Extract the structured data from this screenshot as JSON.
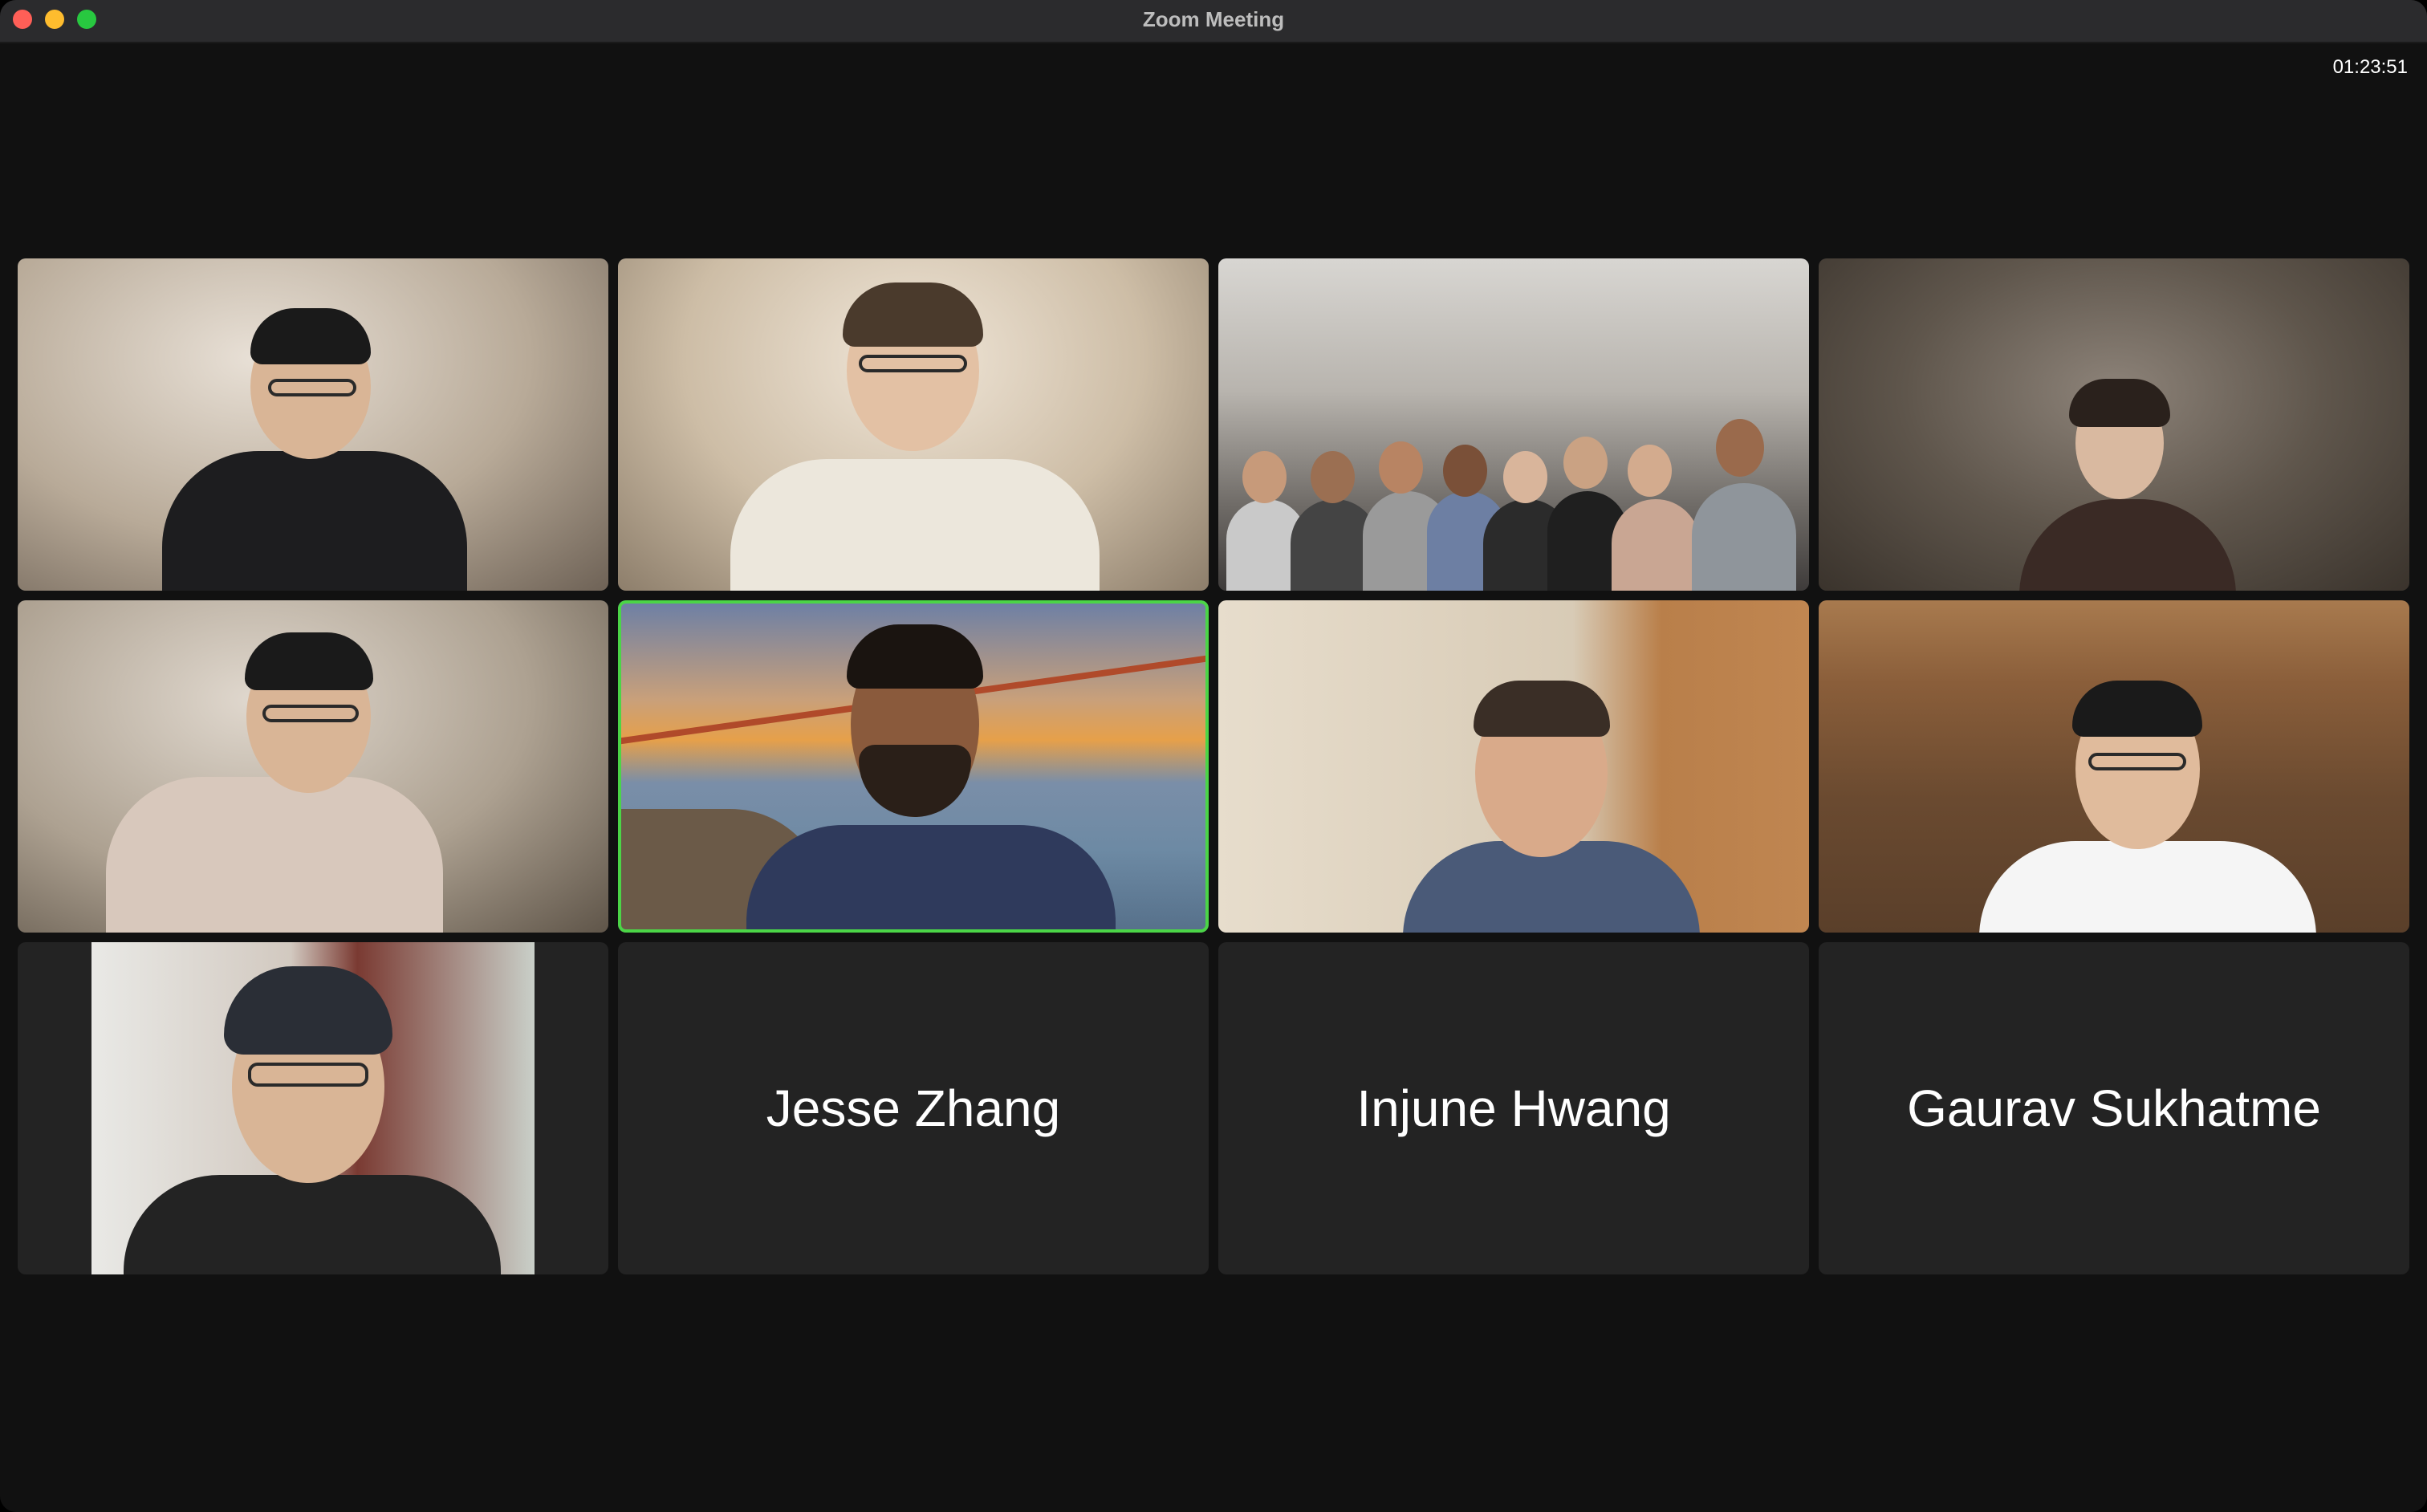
{
  "window": {
    "title": "Zoom Meeting"
  },
  "meeting": {
    "elapsed_time": "01:23:51"
  },
  "participants": [
    {
      "type": "video"
    },
    {
      "type": "video"
    },
    {
      "type": "video"
    },
    {
      "type": "video"
    },
    {
      "type": "video"
    },
    {
      "type": "video",
      "active_speaker": true
    },
    {
      "type": "video"
    },
    {
      "type": "video"
    },
    {
      "type": "video"
    },
    {
      "type": "name",
      "name": "Jesse Zhang"
    },
    {
      "type": "name",
      "name": "Injune Hwang"
    },
    {
      "type": "name",
      "name": "Gaurav Sukhatme"
    }
  ],
  "colors": {
    "background": "#111111",
    "tile": "#232323",
    "active_speaker_border": "#4bd547",
    "titlebar": "#2b2b2d"
  }
}
